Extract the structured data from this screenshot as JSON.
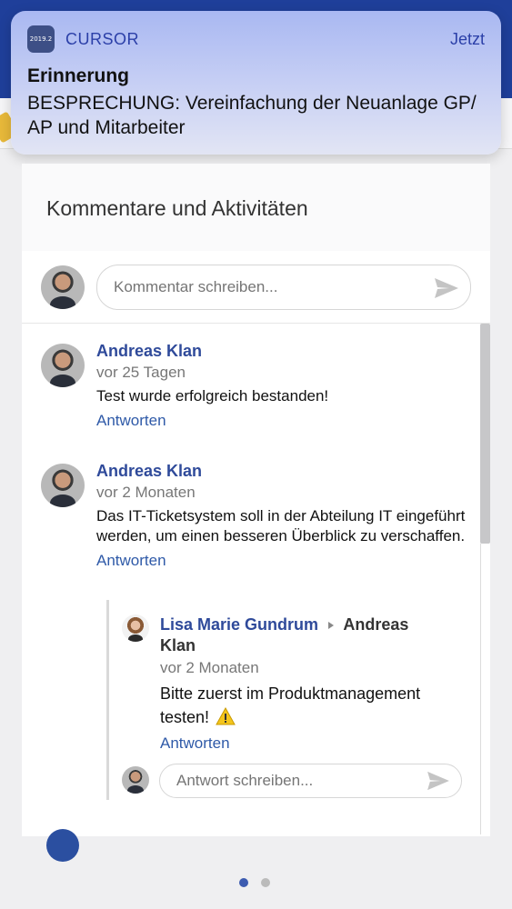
{
  "notification": {
    "app_icon_text": "2019.2",
    "app_name": "CURSOR",
    "time": "Jetzt",
    "title": "Erinnerung",
    "body": "BESPRECHUNG: Vereinfachung der Neuanlage GP/ AP und Mitarbeiter"
  },
  "section": {
    "title": "Kommentare und Aktivitäten"
  },
  "composer": {
    "placeholder": "Kommentar schreiben..."
  },
  "comments": [
    {
      "author": "Andreas Klan",
      "time": "vor 25 Tagen",
      "text": "Test wurde erfolgreich bestanden!",
      "reply_label": "Antworten"
    },
    {
      "author": "Andreas Klan",
      "time": "vor 2 Monaten",
      "text": "Das IT-Ticketsystem soll in der Abteilung IT eingeführt werden, um einen besseren Überblick zu verschaffen.",
      "reply_label": "Antworten",
      "replies": [
        {
          "author": "Lisa Marie Gundrum",
          "recipient": "Andreas Klan",
          "time": "vor 2 Monaten",
          "text": "Bitte zuerst im Produktmanagement testen!",
          "reply_label": "Antworten"
        }
      ],
      "reply_placeholder": "Antwort schreiben..."
    }
  ],
  "pager": {
    "pages": 2,
    "current": 1
  },
  "colors": {
    "accent": "#2f4a9a",
    "link": "#2f5aa8",
    "banner": "#a9b8f2"
  },
  "icons": [
    "send-icon",
    "warning-icon",
    "caret-right-icon"
  ]
}
